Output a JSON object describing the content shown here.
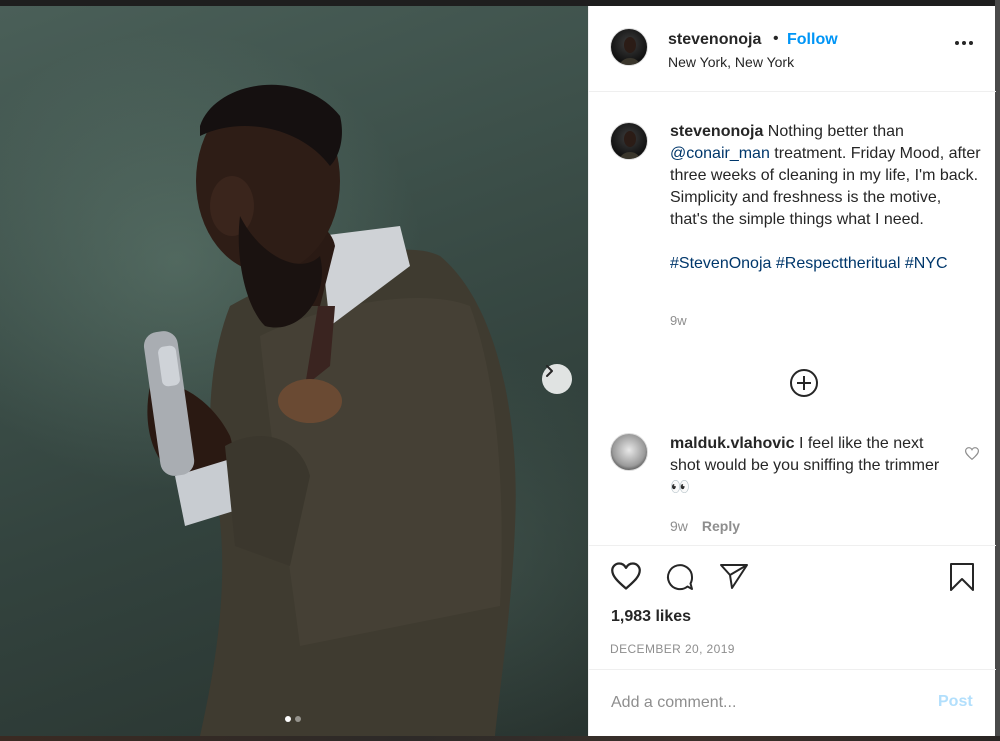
{
  "post": {
    "username": "stevenonoja",
    "bullet": "•",
    "follow_label": "Follow",
    "location": "New York, New York",
    "more_icon": "more-horizontal-icon"
  },
  "caption": {
    "username": "stevenonoja",
    "text_before": " Nothing better than ",
    "mention": "@conair_man",
    "text_after": " treatment. Friday Mood, after three weeks of cleaning in my life, I'm back. Simplicity and freshness is the motive, that's the simple things what I need.",
    "hashtags": [
      "#StevenOnoja",
      "#Respecttheritual",
      "#NYC"
    ],
    "time": "9w"
  },
  "load_more_icon": "plus-circle-icon",
  "comment": {
    "username": "malduk.vlahovic",
    "text": " I feel like the next shot would be you sniffing the trimmer 👀",
    "time": "9w",
    "reply_label": "Reply"
  },
  "actions": {
    "icons": [
      "heart-icon",
      "comment-icon",
      "share-icon",
      "bookmark-icon"
    ],
    "likes": "1,983 likes",
    "date": "DECEMBER 20, 2019"
  },
  "add_comment": {
    "placeholder": "Add a comment...",
    "post_label": "Post"
  },
  "carousel": {
    "slide_count": 2,
    "active_index": 0
  }
}
